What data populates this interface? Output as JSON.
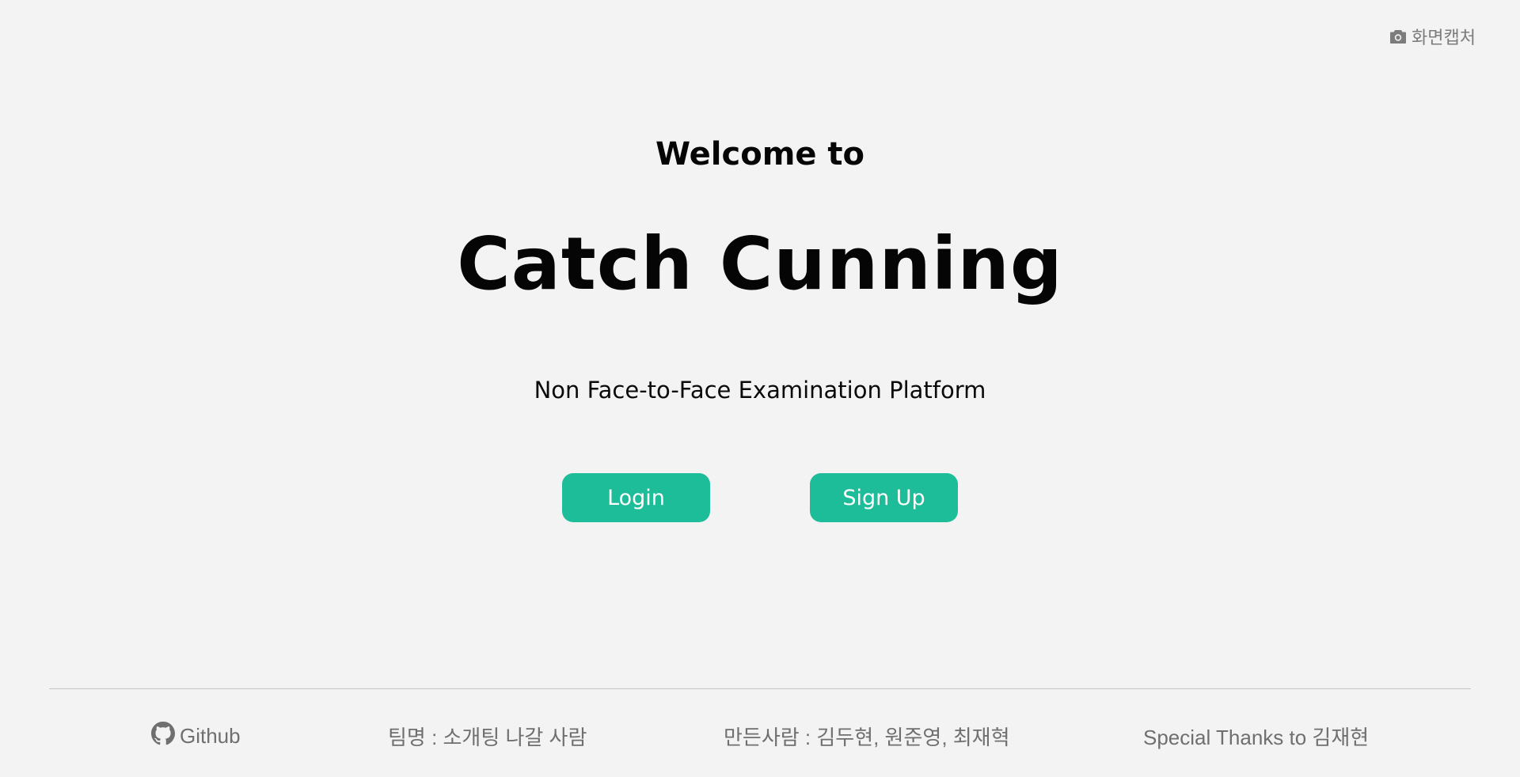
{
  "header": {
    "capture_label": "화면캡처",
    "capture_icon": "camera-icon"
  },
  "hero": {
    "welcome": "Welcome to",
    "title": "Catch Cunning",
    "subtitle": "Non Face-to-Face Examination Platform"
  },
  "actions": {
    "login_label": "Login",
    "signup_label": "Sign Up"
  },
  "footer": {
    "github_label": "Github",
    "github_icon": "github-icon",
    "team": "팀명 : 소개팅 나갈 사람",
    "makers": "만든사람 : 김두현, 원준영, 최재혁",
    "thanks": "Special Thanks to 김재현"
  },
  "colors": {
    "background": "#f3f3f3",
    "accent": "#1dbd9a",
    "muted_text": "#6f6f6f",
    "divider": "#c6c6c6"
  }
}
